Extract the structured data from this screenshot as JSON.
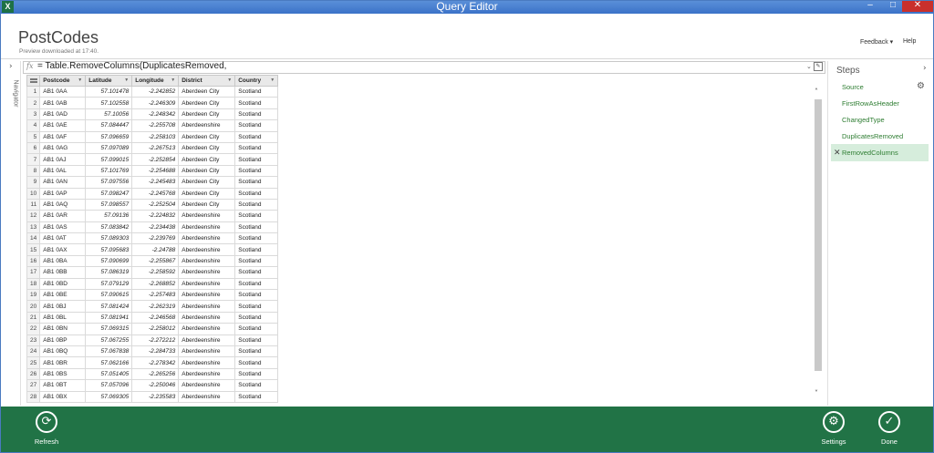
{
  "window": {
    "title": "Query Editor",
    "app_icon": "X",
    "minimize": "–",
    "maximize": "□",
    "close": "✕"
  },
  "header": {
    "query_name": "PostCodes",
    "preview_status": "Preview downloaded at 17:40.",
    "feedback": "Feedback ▾",
    "help": "Help"
  },
  "navigator": {
    "label": "Navigator",
    "chevron": "›"
  },
  "formula": {
    "fx": "fx",
    "text": "= Table.RemoveColumns(DuplicatesRemoved,",
    "expand": "⌄"
  },
  "grid": {
    "columns": [
      "Postcode",
      "Latitude",
      "Longitude",
      "District",
      "Country"
    ],
    "rows": [
      [
        "1",
        "AB1 0AA",
        "57.101478",
        "-2.242852",
        "Aberdeen City",
        "Scotland"
      ],
      [
        "2",
        "AB1 0AB",
        "57.102558",
        "-2.246309",
        "Aberdeen City",
        "Scotland"
      ],
      [
        "3",
        "AB1 0AD",
        "57.10056",
        "-2.248342",
        "Aberdeen City",
        "Scotland"
      ],
      [
        "4",
        "AB1 0AE",
        "57.084447",
        "-2.255708",
        "Aberdeenshire",
        "Scotland"
      ],
      [
        "5",
        "AB1 0AF",
        "57.096659",
        "-2.258103",
        "Aberdeen City",
        "Scotland"
      ],
      [
        "6",
        "AB1 0AG",
        "57.097089",
        "-2.267513",
        "Aberdeen City",
        "Scotland"
      ],
      [
        "7",
        "AB1 0AJ",
        "57.099015",
        "-2.252854",
        "Aberdeen City",
        "Scotland"
      ],
      [
        "8",
        "AB1 0AL",
        "57.101769",
        "-2.254688",
        "Aberdeen City",
        "Scotland"
      ],
      [
        "9",
        "AB1 0AN",
        "57.097556",
        "-2.245483",
        "Aberdeen City",
        "Scotland"
      ],
      [
        "10",
        "AB1 0AP",
        "57.098247",
        "-2.245768",
        "Aberdeen City",
        "Scotland"
      ],
      [
        "11",
        "AB1 0AQ",
        "57.098557",
        "-2.252504",
        "Aberdeen City",
        "Scotland"
      ],
      [
        "12",
        "AB1 0AR",
        "57.09136",
        "-2.224832",
        "Aberdeenshire",
        "Scotland"
      ],
      [
        "13",
        "AB1 0AS",
        "57.083842",
        "-2.234438",
        "Aberdeenshire",
        "Scotland"
      ],
      [
        "14",
        "AB1 0AT",
        "57.089303",
        "-2.239769",
        "Aberdeenshire",
        "Scotland"
      ],
      [
        "15",
        "AB1 0AX",
        "57.095683",
        "-2.24788",
        "Aberdeenshire",
        "Scotland"
      ],
      [
        "16",
        "AB1 0BA",
        "57.090699",
        "-2.255867",
        "Aberdeenshire",
        "Scotland"
      ],
      [
        "17",
        "AB1 0BB",
        "57.086319",
        "-2.258592",
        "Aberdeenshire",
        "Scotland"
      ],
      [
        "18",
        "AB1 0BD",
        "57.079129",
        "-2.268852",
        "Aberdeenshire",
        "Scotland"
      ],
      [
        "19",
        "AB1 0BE",
        "57.090615",
        "-2.257483",
        "Aberdeenshire",
        "Scotland"
      ],
      [
        "20",
        "AB1 0BJ",
        "57.081424",
        "-2.262319",
        "Aberdeenshire",
        "Scotland"
      ],
      [
        "21",
        "AB1 0BL",
        "57.081941",
        "-2.246568",
        "Aberdeenshire",
        "Scotland"
      ],
      [
        "22",
        "AB1 0BN",
        "57.069315",
        "-2.258012",
        "Aberdeenshire",
        "Scotland"
      ],
      [
        "23",
        "AB1 0BP",
        "57.067255",
        "-2.272212",
        "Aberdeenshire",
        "Scotland"
      ],
      [
        "24",
        "AB1 0BQ",
        "57.067838",
        "-2.284733",
        "Aberdeenshire",
        "Scotland"
      ],
      [
        "25",
        "AB1 0BR",
        "57.062166",
        "-2.278342",
        "Aberdeenshire",
        "Scotland"
      ],
      [
        "26",
        "AB1 0BS",
        "57.051405",
        "-2.265256",
        "Aberdeenshire",
        "Scotland"
      ],
      [
        "27",
        "AB1 0BT",
        "57.057096",
        "-2.250046",
        "Aberdeenshire",
        "Scotland"
      ],
      [
        "28",
        "AB1 0BX",
        "57.069305",
        "-2.235583",
        "Aberdeenshire",
        "Scotland"
      ]
    ]
  },
  "scrollbar": {
    "up": "˄",
    "down": "˅"
  },
  "steps": {
    "title": "Steps",
    "collapse": "›",
    "gear": "⚙",
    "remove_icon": "✕",
    "items": [
      "Source",
      "FirstRowAsHeader",
      "ChangedType",
      "DuplicatesRemoved",
      "RemovedColumns"
    ]
  },
  "footer": {
    "refresh": "Refresh",
    "settings": "Settings",
    "done": "Done",
    "refresh_glyph": "⟳",
    "settings_glyph": "⚙",
    "done_glyph": "✓"
  },
  "colors": {
    "titlebar": "#3b72c8",
    "bottom_bar": "#217346",
    "step_text": "#2e7d32",
    "active_step": "#d6eddc"
  }
}
